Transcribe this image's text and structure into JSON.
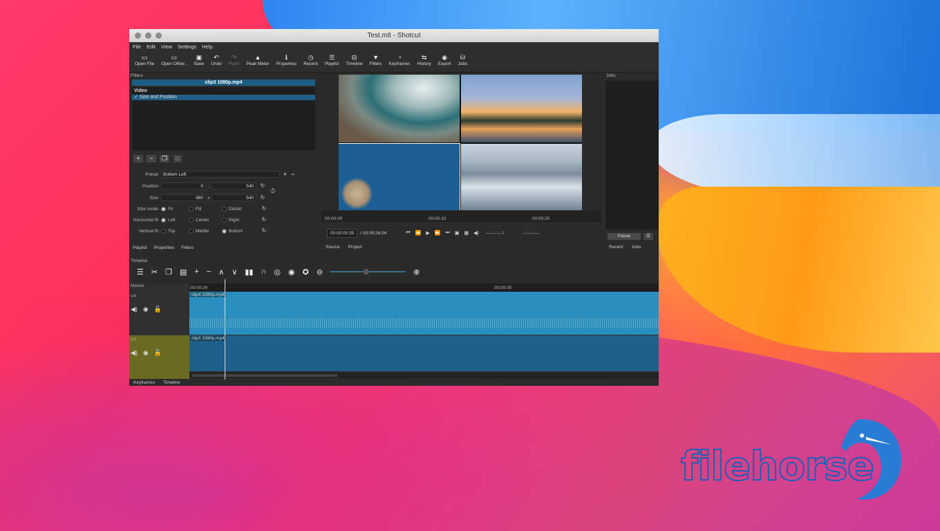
{
  "window": {
    "title": "Test.mlt - Shotcut"
  },
  "menu": [
    "File",
    "Edit",
    "View",
    "Settings",
    "Help"
  ],
  "toolbar": [
    {
      "label": "Open File",
      "icon": "open-file-icon",
      "glyph": "▭"
    },
    {
      "label": "Open Other..",
      "icon": "open-other-icon",
      "glyph": "▭"
    },
    {
      "label": "Save",
      "icon": "save-icon",
      "glyph": "▣"
    },
    {
      "label": "Undo",
      "icon": "undo-icon",
      "glyph": "↶"
    },
    {
      "label": "Redo",
      "icon": "redo-icon",
      "glyph": "↷"
    },
    {
      "label": "Peak Meter",
      "icon": "peak-meter-icon",
      "glyph": "▲"
    },
    {
      "label": "Properties",
      "icon": "info-icon",
      "glyph": "ℹ"
    },
    {
      "label": "Recent",
      "icon": "clock-icon",
      "glyph": "◷"
    },
    {
      "label": "Playlist",
      "icon": "list-icon",
      "glyph": "☰"
    },
    {
      "label": "Timeline",
      "icon": "timeline-icon",
      "glyph": "⊟"
    },
    {
      "label": "Filters",
      "icon": "funnel-icon",
      "glyph": "▼"
    },
    {
      "label": "Keyframes",
      "icon": "stopwatch-icon",
      "glyph": "◔"
    },
    {
      "label": "History",
      "icon": "history-icon",
      "glyph": "⇆"
    },
    {
      "label": "Export",
      "icon": "export-icon",
      "glyph": "◉"
    },
    {
      "label": "Jobs",
      "icon": "jobs-icon",
      "glyph": "⛁"
    }
  ],
  "filters": {
    "title": "Filters",
    "clip": "clip3 1080p.mp4",
    "section": "Video",
    "item": "Size and Position",
    "preset_label": "Preset",
    "preset_value": "Bottom Left",
    "position_label": "Position",
    "position_x": "0",
    "position_y": "540",
    "size_label": "Size",
    "size_w": "960",
    "size_h": "540",
    "sizemode_label": "Size mode",
    "sizemode": [
      "Fit",
      "Fill",
      "Distort"
    ],
    "hfit_label": "Horizontal fit",
    "hfit": [
      "Left",
      "Center",
      "Right"
    ],
    "vfit_label": "Vertical fit",
    "vfit": [
      "Top",
      "Middle",
      "Bottom"
    ],
    "comma": ",",
    "times": "x",
    "tabs": [
      "Playlist",
      "Properties",
      "Filters"
    ]
  },
  "viewer": {
    "ruler": [
      "00:00:00",
      "00:00:10",
      "00:00:20"
    ],
    "current_tc": "00:00:00:35",
    "total_tc": "/ 00:00:26:04",
    "in_out": "--:--:--:-- /",
    "dur": "--:--:--:--",
    "tabs": [
      "Source",
      "Project"
    ]
  },
  "jobs": {
    "title": "Jobs",
    "pause": "Pause",
    "tabs": [
      "Recent",
      "Jobs"
    ]
  },
  "timeline": {
    "title": "Timeline",
    "master": "Master",
    "ruler": [
      "00:00:00",
      "00:00:05"
    ],
    "tracks": [
      {
        "name": "V4",
        "clip": "clip4 1080p.mp4"
      },
      {
        "name": "V3",
        "clip": "clip3 1080p.mp4"
      }
    ],
    "bottom_tabs": [
      "Keyframes",
      "Timeline"
    ]
  },
  "watermark": {
    "text": "filehorse"
  }
}
